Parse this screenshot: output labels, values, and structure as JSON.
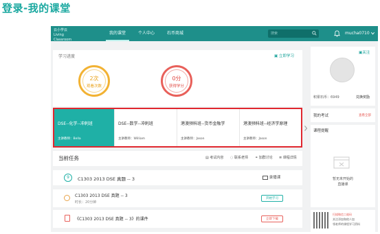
{
  "page_heading": "登录-我的课堂",
  "topbar": {
    "logo_line1": "云小学云",
    "logo_line2": "Living Classroom",
    "nav": [
      "我的课堂",
      "个人中心",
      "石币商城"
    ],
    "active_nav": "我的课堂",
    "search_placeholder": "搜索",
    "username": "mucha0710"
  },
  "progress": {
    "title": "学习进度",
    "link": "立即学习",
    "rings": [
      {
        "value": "2次",
        "caption": "观看次数",
        "color": "#f2b233"
      },
      {
        "value": "0分",
        "caption": "获得学分",
        "color": "#e8605a"
      }
    ]
  },
  "profile": {
    "follow_label": "关注",
    "points_label": "积累石币：6949",
    "redeem_label": "兑换奖励",
    "exam_label": "我的考试",
    "exam_link": "查看全部",
    "prompt_title": "课程提醒",
    "empty_text_1": "暂无未开始的",
    "empty_text_2": "直播课"
  },
  "courses": [
    {
      "title": "DSE--化学--冲刺班",
      "teacher": "主讲教师：Bella",
      "active": true
    },
    {
      "title": "DSE--数学--冲刺班",
      "teacher": "主讲教师：William",
      "active": false
    },
    {
      "title": "港澳预科班--货币金融学",
      "teacher": "主讲教师：Jason",
      "active": false
    },
    {
      "title": "港澳预科班--经济学原理",
      "teacher": "主讲教师：Jason",
      "active": false
    }
  ],
  "tasks": {
    "title": "当前任务",
    "tabs": [
      "考试内容",
      "联系老师",
      "加群讨论",
      "课程详情"
    ],
    "lesson_num": "9",
    "lesson_title": "C1303 2013 DSE 真题 -- 3",
    "lesson_status": "录播课",
    "items": [
      {
        "title": "C1303 2013 DSE 真题 -- 3",
        "sub": "时长：20分钟",
        "button": "开始学习"
      },
      {
        "title": "《C1303 2013 DSE 真题 -- 3》的课件",
        "sub": "",
        "button": "立即下载"
      }
    ]
  },
  "promo": {
    "line1": "扫描微信二维码",
    "line2": "关注添加和他人加",
    "line3": "领老师的课程学习资料"
  }
}
